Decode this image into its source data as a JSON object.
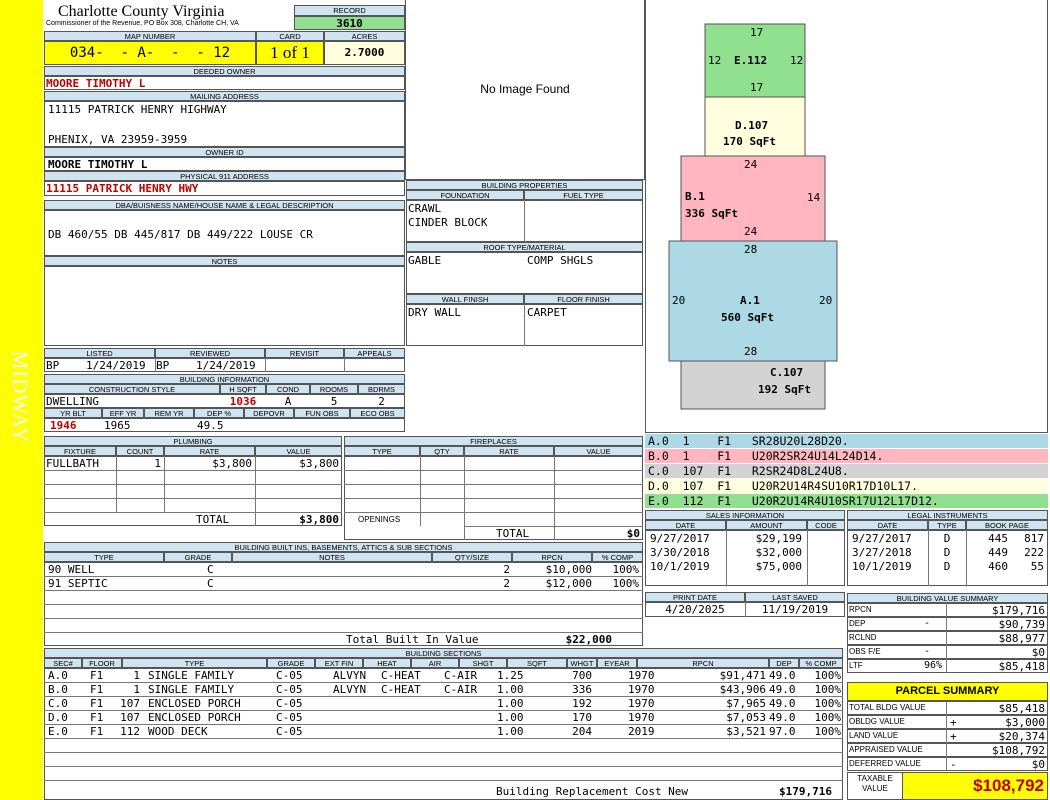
{
  "sidebar": {
    "label": "MIDWAY",
    "color": "#ffff00"
  },
  "header": {
    "county": "Charlotte County Virginia",
    "commissioner": "Commissioner of the Revenue, PO Box 308, Charlotte CH, VA",
    "record_label": "RECORD",
    "record": "3610",
    "map_number_label": "MAP NUMBER",
    "map_number": "034-  - A-  -  - 12",
    "card_label": "CARD",
    "card": "1 of 1",
    "acres_label": "ACRES",
    "acres": "2.7000"
  },
  "owner": {
    "deeded_owner_label": "DEEDED OWNER",
    "deeded_owner": "MOORE TIMOTHY L",
    "mailing_label": "MAILING ADDRESS",
    "mailing_line1": "11115 PATRICK HENRY HIGHWAY",
    "mailing_line2": "PHENIX, VA 23959-3959",
    "owner_id_label": "OWNER ID",
    "owner_id": "MOORE TIMOTHY L",
    "physical_label": "PHYSICAL 911 ADDRESS",
    "physical": "11115 PATRICK HENRY HWY",
    "dba_label": "DBA/BUISNESS NAME/HOUSE NAME & LEGAL DESCRIPTION",
    "legal_desc": "DB 460/55 DB 445/817 DB 449/222 LOUSE CR",
    "notes_label": "NOTES"
  },
  "photo": {
    "text": "No Image Found"
  },
  "building_props": {
    "title": "BUILDING PROPERTIES",
    "foundation_label": "FOUNDATION",
    "fueltype_label": "FUEL TYPE",
    "foundation1": "CRAWL",
    "foundation2": "CINDER BLOCK",
    "roof_label": "ROOF TYPE/MATERIAL",
    "roof_type": "GABLE",
    "roof_material": "COMP SHGLS",
    "wall_label": "WALL FINISH",
    "floor_label": "FLOOR FINISH",
    "wall": "DRY WALL",
    "floor": "CARPET"
  },
  "listing": {
    "listed_label": "LISTED",
    "reviewed_label": "REVIEWED",
    "revisit_label": "REVISIT",
    "appeals_label": "APPEALS",
    "listed_by": "BP",
    "listed_date": "1/24/2019",
    "reviewed_by": "BP",
    "reviewed_date": "1/24/2019"
  },
  "building_info": {
    "title": "BUILDING INFORMATION",
    "style_label": "CONSTRUCTION STYLE",
    "hsqft_label": "H SQFT",
    "cond_label": "COND",
    "rooms_label": "ROOMS",
    "bdrms_label": "BDRMS",
    "style": "DWELLING",
    "hsqft": "1036",
    "cond": "A",
    "rooms": "5",
    "bdrms": "2",
    "yrblt_label": "YR BLT",
    "effyr_label": "EFF YR",
    "remyr_label": "REM YR",
    "dep_label": "DEP %",
    "depovr_label": "DEPOVR",
    "funobs_label": "FUN OBS",
    "ecoobs_label": "ECO OBS",
    "yrblt": "1946",
    "effyr": "1965",
    "dep": "49.5"
  },
  "plumbing": {
    "title": "PLUMBING",
    "headers": [
      "FIXTURE",
      "COUNT",
      "RATE",
      "VALUE"
    ],
    "rows": [
      {
        "fixture": "FULLBATH",
        "count": "1",
        "rate": "$3,800",
        "value": "$3,800"
      }
    ],
    "total_label": "TOTAL",
    "total": "$3,800"
  },
  "fireplaces": {
    "title": "FIREPLACES",
    "headers": [
      "TYPE",
      "QTY",
      "RATE",
      "VALUE"
    ],
    "openings_label": "OPENINGS",
    "total_label": "TOTAL",
    "total": "$0"
  },
  "builtins": {
    "title": "BUILDING BUILT INS, BASEMENTS, ATTICS & SUB SECTIONS",
    "headers": [
      "TYPE",
      "GRADE",
      "NOTES",
      "QTY/SIZE",
      "RPCN",
      "% COMP"
    ],
    "rows": [
      {
        "type": "90 WELL",
        "grade": "C",
        "notes": "",
        "qty": "2",
        "rpcn": "$10,000",
        "comp": "100%"
      },
      {
        "type": "91 SEPTIC",
        "grade": "C",
        "notes": "",
        "qty": "2",
        "rpcn": "$12,000",
        "comp": "100%"
      }
    ],
    "total_label": "Total Built In Value",
    "total": "$22,000"
  },
  "sections": {
    "title": "BUILDING SECTIONS",
    "headers": [
      "SEC#",
      "FLOOR",
      "TYPE",
      "GRADE",
      "EXT FIN",
      "HEAT",
      "AIR",
      "SHGT",
      "SQFT",
      "WHGT",
      "EYEAR",
      "RPCN",
      "DEP",
      "% COMP"
    ],
    "rows": [
      {
        "sec": "A.0",
        "floor": "F1",
        "code": "1",
        "type": "SINGLE FAMILY",
        "grade": "C-05",
        "extfin": "ALVYN",
        "heat": "C-HEAT",
        "air": "C-AIR",
        "shgt": "1.25",
        "sqft": "700",
        "eyear": "1970",
        "rpcn": "$91,471",
        "dep": "49.0",
        "comp": "100%"
      },
      {
        "sec": "B.0",
        "floor": "F1",
        "code": "1",
        "type": "SINGLE FAMILY",
        "grade": "C-05",
        "extfin": "ALVYN",
        "heat": "C-HEAT",
        "air": "C-AIR",
        "shgt": "1.00",
        "sqft": "336",
        "eyear": "1970",
        "rpcn": "$43,906",
        "dep": "49.0",
        "comp": "100%"
      },
      {
        "sec": "C.0",
        "floor": "F1",
        "code": "107",
        "type": "ENCLOSED PORCH",
        "grade": "C-05",
        "extfin": "",
        "heat": "",
        "air": "",
        "shgt": "1.00",
        "sqft": "192",
        "eyear": "1970",
        "rpcn": "$7,965",
        "dep": "49.0",
        "comp": "100%"
      },
      {
        "sec": "D.0",
        "floor": "F1",
        "code": "107",
        "type": "ENCLOSED PORCH",
        "grade": "C-05",
        "extfin": "",
        "heat": "",
        "air": "",
        "shgt": "1.00",
        "sqft": "170",
        "eyear": "1970",
        "rpcn": "$7,053",
        "dep": "49.0",
        "comp": "100%"
      },
      {
        "sec": "E.0",
        "floor": "F1",
        "code": "112",
        "type": "WOOD DECK",
        "grade": "C-05",
        "extfin": "",
        "heat": "",
        "air": "",
        "shgt": "1.00",
        "sqft": "204",
        "eyear": "2019",
        "rpcn": "$3,521",
        "dep": "97.0",
        "comp": "100%"
      }
    ],
    "total_label": "Building Replacement Cost New",
    "total": "$179,716"
  },
  "sketch": {
    "sections": [
      {
        "label": "E.112",
        "sqft": "",
        "sides": [
          "17",
          "12",
          "17",
          "12"
        ],
        "color": "#90e090"
      },
      {
        "label": "D.107",
        "sqft": "170 SqFt",
        "sides": [],
        "color": "#ffffe0"
      },
      {
        "label": "B.1",
        "sqft": "336 SqFt",
        "sides": [
          "24",
          "14",
          "24",
          "14"
        ],
        "color": "#ffb6c1"
      },
      {
        "label": "A.1",
        "sqft": "560 SqFt",
        "sides": [
          "28",
          "20",
          "28",
          "20"
        ],
        "color": "#add8e6"
      },
      {
        "label": "C.107",
        "sqft": "192 SqFt",
        "sides": [],
        "color": "#d3d3d3"
      }
    ]
  },
  "sketch_legend": [
    {
      "text": "A.0  1    F1   SR28U20L28D20.",
      "color": "#add8e6"
    },
    {
      "text": "B.0  1    F1   U20R2SR24U14L24D14.",
      "color": "#ffb6c1"
    },
    {
      "text": "C.0  107  F1   R2SR24D8L24U8.",
      "color": "#d3d3d3"
    },
    {
      "text": "D.0  107  F1   U20R2U14R4SU10R17D10L17.",
      "color": "#ffffe0"
    },
    {
      "text": "E.0  112  F1   U20R2U14R4U10SR17U12L17D12.",
      "color": "#90e090"
    }
  ],
  "sales": {
    "title": "SALES INFORMATION",
    "headers": [
      "DATE",
      "AMOUNT",
      "CODE"
    ],
    "rows": [
      {
        "date": "9/27/2017",
        "amount": "$29,199",
        "code": ""
      },
      {
        "date": "3/30/2018",
        "amount": "$32,000",
        "code": ""
      },
      {
        "date": "10/1/2019",
        "amount": "$75,000",
        "code": ""
      }
    ]
  },
  "legal": {
    "title": "LEGAL INSTRUMENTS",
    "headers": [
      "DATE",
      "TYPE",
      "BOOK PAGE"
    ],
    "rows": [
      {
        "date": "9/27/2017",
        "type": "D",
        "book": "445",
        "page": "817"
      },
      {
        "date": "3/27/2018",
        "type": "D",
        "book": "449",
        "page": "222"
      },
      {
        "date": "10/1/2019",
        "type": "D",
        "book": "460",
        "page": "55"
      }
    ]
  },
  "print": {
    "print_label": "PRINT DATE",
    "saved_label": "LAST SAVED",
    "print_date": "4/20/2025",
    "saved_date": "11/19/2019"
  },
  "value_summary": {
    "title": "BUILDING VALUE SUMMARY",
    "rows": [
      {
        "label": "RPCN",
        "sign": "",
        "value": "$179,716"
      },
      {
        "label": "DEP",
        "sign": "-",
        "value": "$90,739"
      },
      {
        "label": "RCLND",
        "sign": "",
        "value": "$88,977"
      },
      {
        "label": "OBS F/E",
        "sign": "-",
        "value": "$0"
      },
      {
        "label": "LTF",
        "sign": "96%",
        "value": "$85,418"
      }
    ]
  },
  "parcel": {
    "title": "PARCEL SUMMARY",
    "rows": [
      {
        "label": "TOTAL BLDG VALUE",
        "sign": "",
        "value": "$85,418"
      },
      {
        "label": "OBLDG VALUE",
        "sign": "+",
        "value": "$3,000"
      },
      {
        "label": "LAND VALUE",
        "sign": "+",
        "value": "$20,374"
      },
      {
        "label": "APPRAISED VALUE",
        "sign": "",
        "value": "$108,792"
      },
      {
        "label": "DEFERRED VALUE",
        "sign": "-",
        "value": "$0"
      }
    ],
    "taxable_label": "TAXABLE VALUE",
    "taxable": "$108,792"
  }
}
